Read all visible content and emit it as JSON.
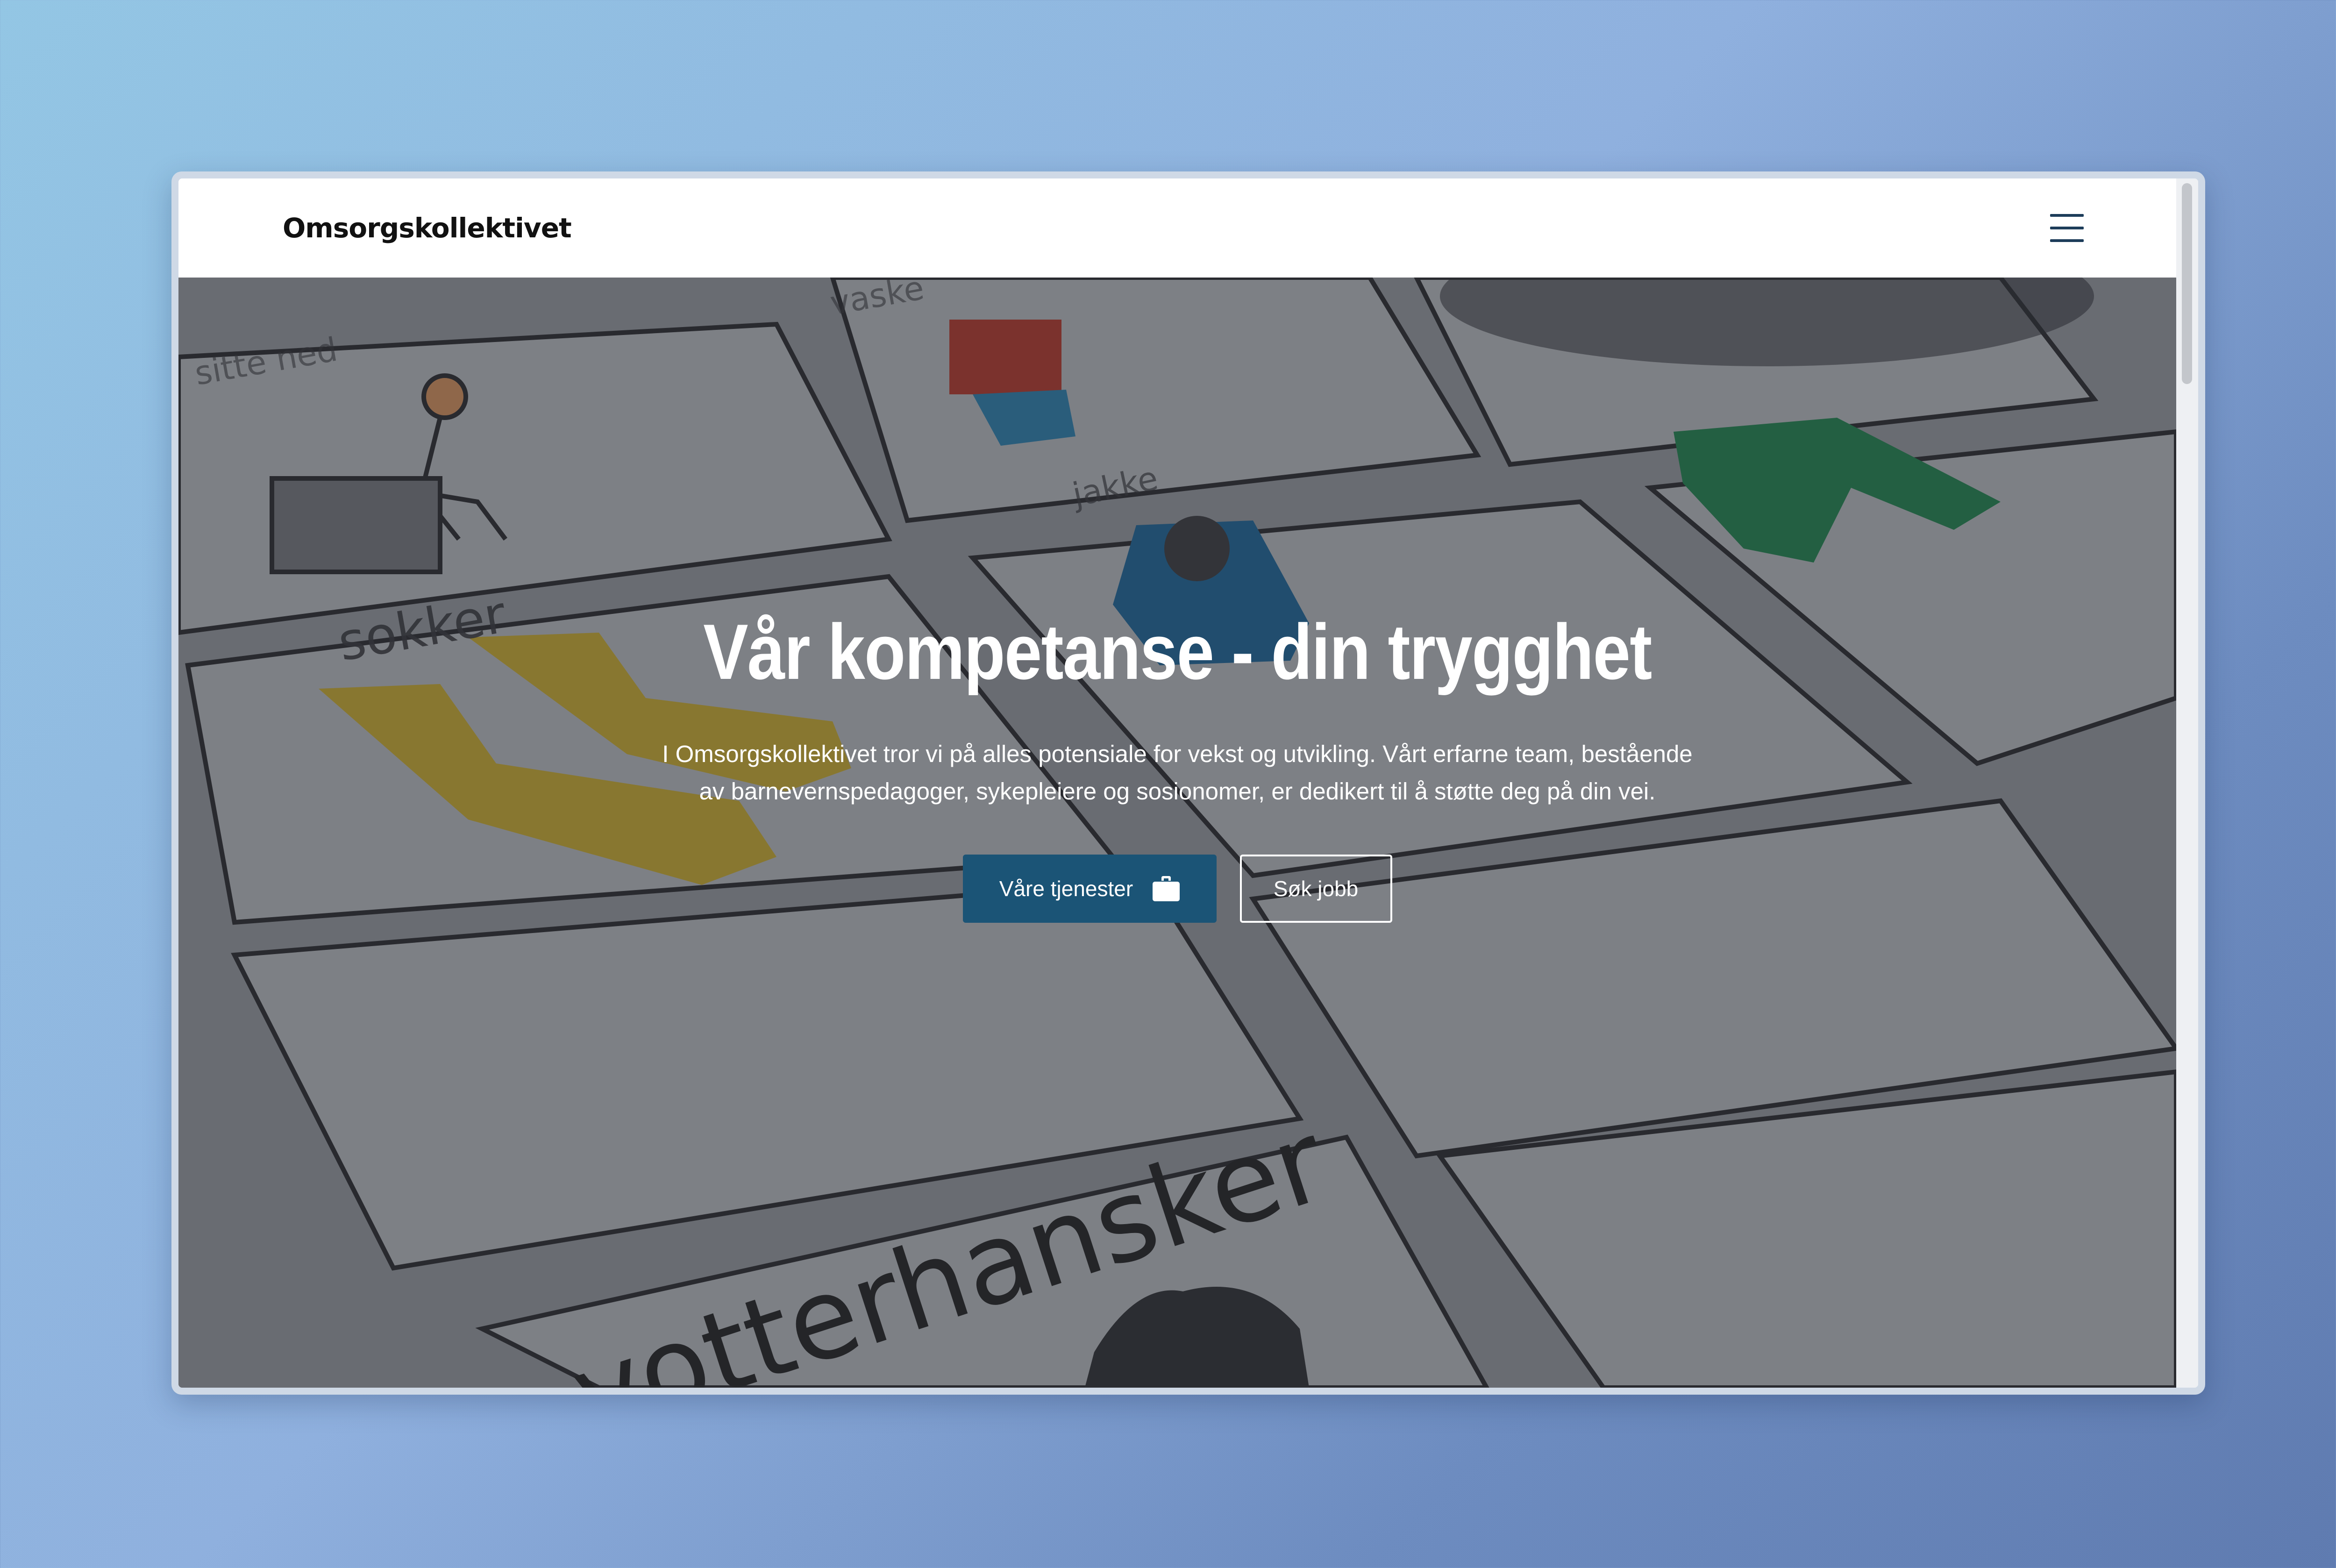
{
  "nav": {
    "brand": "Omsorgskollektivet",
    "menu_icon": "hamburger-menu-icon"
  },
  "hero": {
    "title": "Vår kompetanse - din trygghet",
    "text": "I Omsorgskollektivet tror vi på alles potensiale for vekst og utvikling. Vårt erfarne team, bestående av barnevernspedagoger, sykepleiere og sosionomer, er dedikert til å støtte deg på din vei.",
    "primary_button": {
      "label": "Våre tjenester",
      "icon": "briefcase-icon"
    },
    "secondary_button": {
      "label": "Søk jobb"
    },
    "background": {
      "description_words": [
        "sokker",
        "jakke",
        "votterhanser"
      ],
      "picture_words": [
        "sitte ned",
        "vaske",
        "jakke",
        "sokker",
        "votterhansker"
      ]
    }
  },
  "colors": {
    "primary_button": "#1b5476",
    "nav_icon": "#1d3d5a",
    "page_background": "#8fb0de"
  }
}
